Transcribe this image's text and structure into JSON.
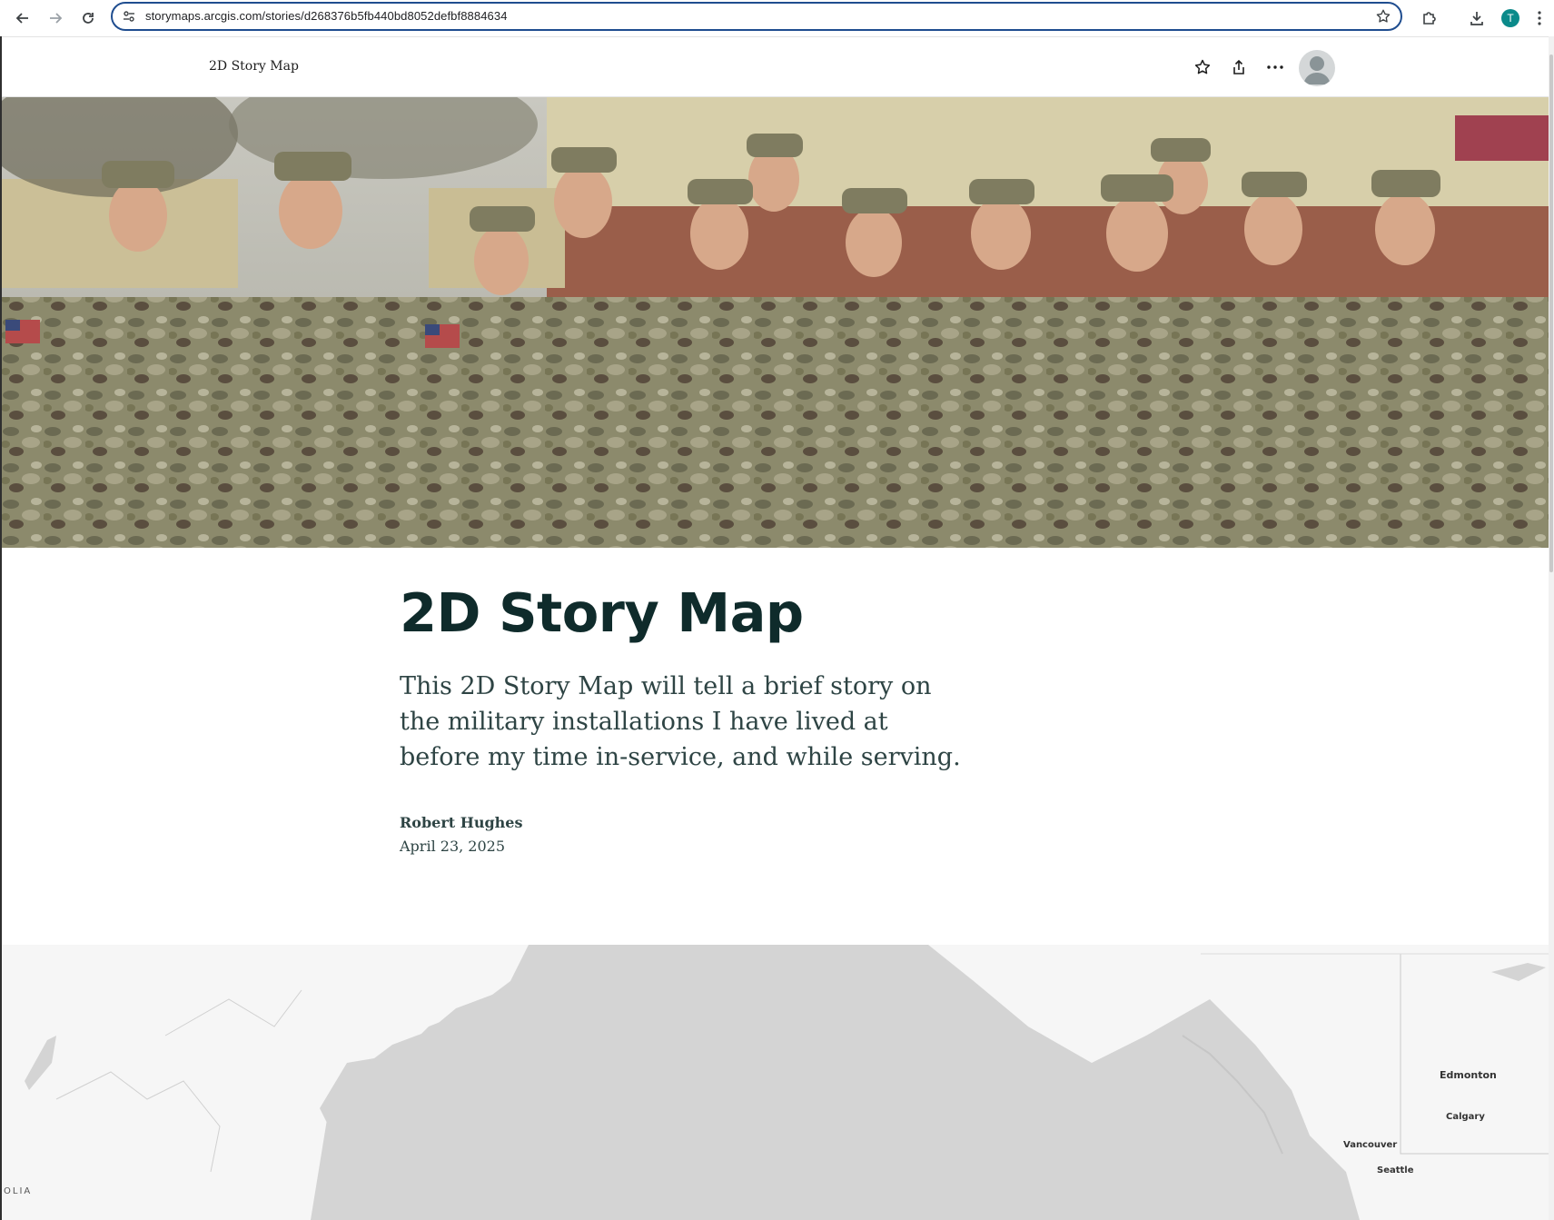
{
  "browser": {
    "url": "storymaps.arcgis.com/stories/d268376b5fb440bd8052defbf8884634",
    "profile_initial": "T"
  },
  "story_header": {
    "title": "2D Story Map"
  },
  "story": {
    "title": "2D Story Map",
    "subtitle": "This 2D Story Map will tell a brief story on the military installations I have lived at before my time in-service, and while serving.",
    "author": "Robert Hughes",
    "date": "April 23, 2025"
  },
  "map": {
    "labels": {
      "edmonton": "Edmonton",
      "calgary": "Calgary",
      "vancouver": "Vancouver",
      "seattle": "Seattle",
      "mongolia": "OLIA"
    }
  },
  "colors": {
    "title": "#0f2b2b",
    "text": "#2e4444",
    "omnibox_border": "#1f4d8f",
    "profile_badge": "#0b8a8a",
    "map_land": "#f6f6f6",
    "map_water": "#d4d4d4"
  },
  "icons": {
    "back": "arrow-left-icon",
    "forward": "arrow-right-icon",
    "reload": "reload-icon",
    "site_info": "tune-icon",
    "bookmark": "star-icon",
    "extensions": "puzzle-icon",
    "downloads": "download-icon",
    "menu": "kebab-icon",
    "favorite": "star-icon",
    "share": "share-icon",
    "more": "ellipsis-icon",
    "avatar": "user-avatar-icon"
  }
}
